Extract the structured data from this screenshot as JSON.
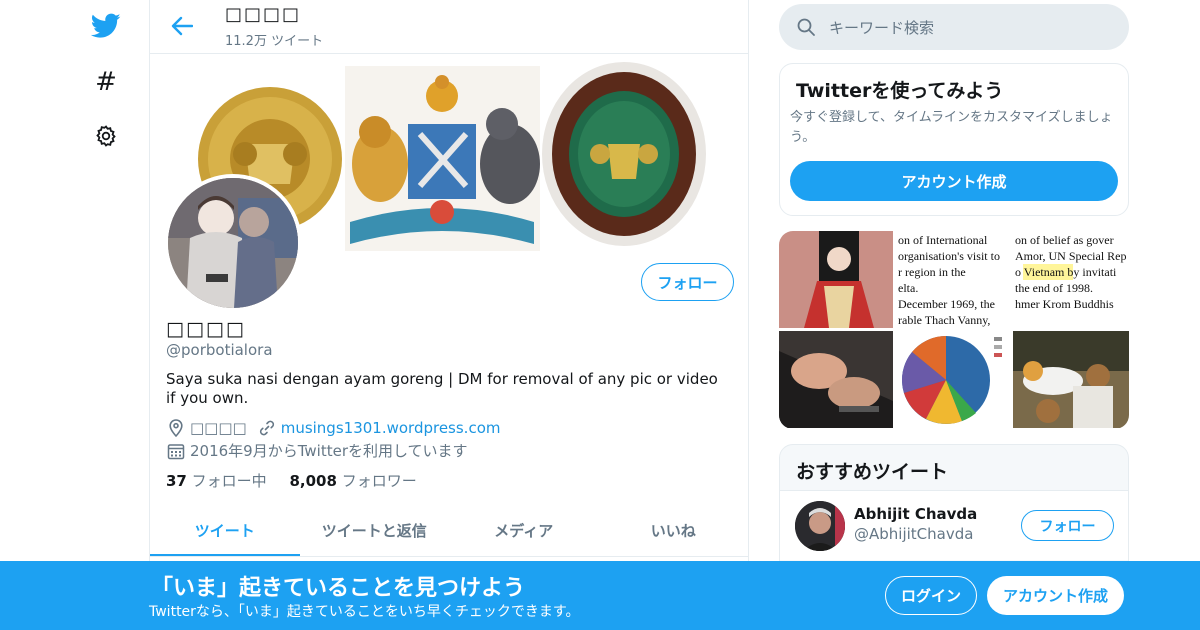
{
  "nav": {
    "logo_icon": "twitter-bird-icon",
    "explore_icon": "hashtag-icon",
    "explore_glyph": "#",
    "settings_icon": "gear-icon"
  },
  "header": {
    "name": "□□□□",
    "tweet_count": "11.2万 ツイート"
  },
  "profile": {
    "display_name": "□□□□",
    "handle": "@porbotialora",
    "bio": "Saya suka nasi dengan ayam goreng | DM for removal of any pic or video if you own.",
    "location": "□□□□",
    "website": "musings1301.wordpress.com",
    "joined": "2016年9月からTwitterを利用しています",
    "following_count": "37",
    "following_label": "フォロー中",
    "followers_count": "8,008",
    "followers_label": "フォロワー",
    "follow_label": "フォロー"
  },
  "tabs": [
    {
      "label": "ツイート",
      "active": true
    },
    {
      "label": "ツイートと返信",
      "active": false
    },
    {
      "label": "メディア",
      "active": false
    },
    {
      "label": "いいね",
      "active": false
    }
  ],
  "search": {
    "placeholder": "キーワード検索"
  },
  "signup_card": {
    "title": "Twitterを使ってみよう",
    "description": "今すぐ登録して、タイムラインをカスタマイズしましょう。",
    "button": "アカウント作成"
  },
  "media_thumbs": {
    "text_top_mid": [
      "on of International",
      "organisation's visit to",
      "r region in the",
      "elta.",
      "December 1969, the",
      "rable Thach Vanny,"
    ],
    "text_top_right": [
      "on of belief as gover",
      "Amor, UN Special Rep",
      "o Vietnam by invitati",
      "the end of 1998.",
      "hmer Krom Buddhis"
    ]
  },
  "recommended": {
    "title": "おすすめツイート",
    "items": [
      {
        "name": "Abhijit Chavda",
        "handle": "@AbhijitChavda",
        "button": "フォロー"
      }
    ]
  },
  "bottom_bar": {
    "title": "「いま」起きていることを見つけよう",
    "subtitle": "Twitterなら、「いま」起きていることをいち早くチェックできます。",
    "login": "ログイン",
    "signup": "アカウント作成"
  },
  "colors": {
    "accent": "#1da1f2",
    "link": "#1b95e0",
    "muted": "#657786"
  }
}
